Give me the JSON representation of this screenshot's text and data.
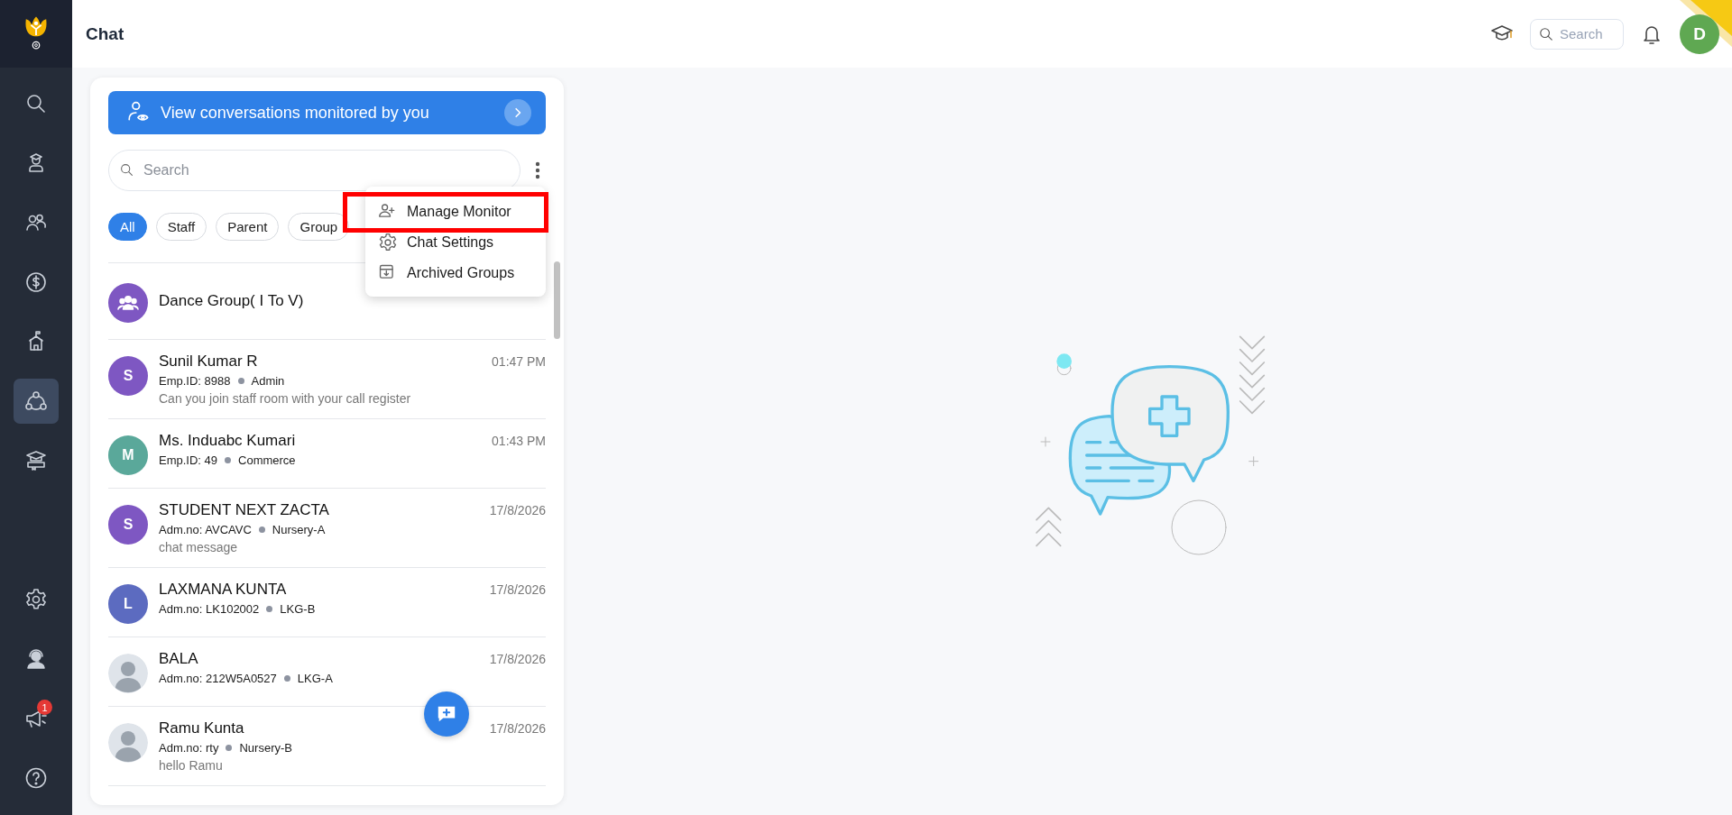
{
  "sidebar": {
    "items": [
      {
        "kind": "search",
        "selected": false
      },
      {
        "kind": "student",
        "selected": false
      },
      {
        "kind": "people",
        "selected": false
      },
      {
        "kind": "dollar",
        "selected": false
      },
      {
        "kind": "school",
        "selected": false
      },
      {
        "kind": "network",
        "selected": true
      },
      {
        "kind": "graduation",
        "selected": false
      }
    ],
    "bottom_items": [
      {
        "kind": "settings",
        "selected": false
      },
      {
        "kind": "support",
        "selected": false
      },
      {
        "kind": "announcement",
        "selected": false,
        "badge": "1"
      },
      {
        "kind": "help",
        "selected": false
      }
    ]
  },
  "header": {
    "title": "Chat",
    "search": {
      "placeholder": "Search"
    },
    "avatar": {
      "initial": "D",
      "color": "#5fa852"
    }
  },
  "monitor_banner": {
    "label": "View conversations monitored by you"
  },
  "search": {
    "placeholder": "Search"
  },
  "filters": [
    {
      "label": "All",
      "selected": true
    },
    {
      "label": "Staff",
      "selected": false
    },
    {
      "label": "Parent",
      "selected": false
    },
    {
      "label": "Group",
      "selected": false
    }
  ],
  "menu": {
    "items": [
      {
        "kind": "manage",
        "label": "Manage Monitor",
        "highlighted": true
      },
      {
        "kind": "settings",
        "label": "Chat Settings",
        "highlighted": false
      },
      {
        "kind": "archive",
        "label": "Archived Groups",
        "highlighted": false
      }
    ]
  },
  "conversations": [
    {
      "kind": "group",
      "name": "Dance Group( I To V)",
      "color": "#7e57c2"
    },
    {
      "kind": "initial",
      "initial": "S",
      "color": "#7e57c2",
      "name": "Sunil Kumar R",
      "time": "01:47 PM",
      "id_label": "Emp.ID: 8988",
      "role": "Admin",
      "message": "Can you join staff room with your call register"
    },
    {
      "kind": "initial",
      "initial": "M",
      "color": "#5aa89a",
      "name": "Ms. Induabc Kumari",
      "time": "01:43 PM",
      "id_label": "Emp.ID: 49",
      "role": "Commerce"
    },
    {
      "kind": "initial",
      "initial": "S",
      "color": "#7e57c2",
      "name": "STUDENT NEXT ZACTA",
      "time": "17/8/2026",
      "id_label": "Adm.no: AVCAVC",
      "role": "Nursery-A",
      "message": "chat message"
    },
    {
      "kind": "initial",
      "initial": "L",
      "color": "#5c6bc0",
      "name": "LAXMANA KUNTA",
      "time": "17/8/2026",
      "id_label": "Adm.no: LK102002",
      "role": "LKG-B"
    },
    {
      "kind": "photo",
      "name": "BALA",
      "time": "17/8/2026",
      "id_label": "Adm.no: 212W5A0527",
      "role": "LKG-A"
    },
    {
      "kind": "photo",
      "name": "Ramu Kunta",
      "time": "17/8/2026",
      "id_label": "Adm.no: rty",
      "role": "Nursery-B",
      "message": "hello Ramu"
    }
  ]
}
